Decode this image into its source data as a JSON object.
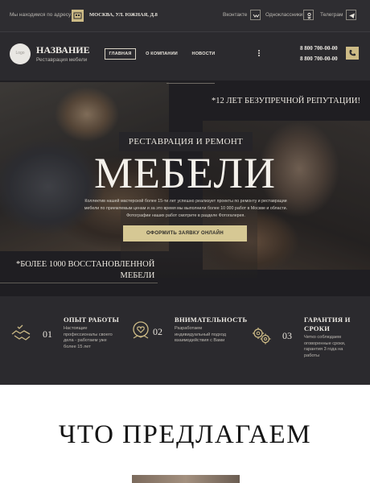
{
  "topbar": {
    "address_label": "Мы находимся по адресу:",
    "address": "МОСКВА, УЛ. ЮЖНАЯ, Д.8",
    "socials": [
      {
        "label": "Вконтакте",
        "icon": "vk-icon"
      },
      {
        "label": "Одноклассники",
        "icon": "odnoklassniki-icon"
      },
      {
        "label": "Телеграм",
        "icon": "telegram-icon"
      }
    ]
  },
  "header": {
    "logo_text": "Logo",
    "brand": "НАЗВАНИЕ",
    "brand_sub": "Реставрация мебели",
    "nav": [
      "ГЛАВНАЯ",
      "О КОМПАНИИ",
      "НОВОСТИ"
    ],
    "phones": [
      "8 800 700-00-00",
      "8 800 700-00-00"
    ]
  },
  "hero": {
    "tagline_top": "*12 ЛЕТ БЕЗУПРЕЧНОЙ РЕПУТАЦИИ!",
    "title_small": "РЕСТАВРАЦИЯ И РЕМОНТ",
    "title_big": "МЕБЕЛИ",
    "description": "Коллектив нашей мастерской более 15-ти лет успешно реализует проекты по ремонту и реставрации мебели по приемлемым ценам и за это время мы выполнили более 10 000 работ в Москве и области. Фотографии наших работ смотрите в разделе Фотогалерея.",
    "cta": "ОФОРМИТЬ ЗАЯВКУ ОНЛАЙН",
    "tagline_bottom_1": "*БОЛЕЕ 1000 ВОССТАНОВЛЕННОЙ",
    "tagline_bottom_2": "МЕБЕЛИ"
  },
  "features": [
    {
      "num": "01",
      "title": "ОПЫТ РАБОТЫ",
      "text_1": "Настоящие",
      "text_2": "профессионалы своего",
      "text_3": "дела - работаем уже",
      "text_4": "более 15 лет",
      "icon": "handshake-icon"
    },
    {
      "num": "02",
      "title": "ВНИМАТЕЛЬНОСТЬ",
      "text_1": "Разработаем",
      "text_2": "индивидуальный подход",
      "text_3": "взаимодействия с Вами",
      "text_4": "",
      "icon": "heart-hands-icon"
    },
    {
      "num": "03",
      "title_1": "ГАРАНТИЯ И",
      "title_2": "СРОКИ",
      "text_1": "Четко соблюдаем",
      "text_2": "оговоренные сроки,",
      "text_3": "гарантия 3 года на",
      "text_4": "работы",
      "icon": "gears-icon"
    }
  ],
  "offer": {
    "title": "ЧТО ПРЕДЛАГАЕМ"
  },
  "colors": {
    "accent": "#cdbb86",
    "dark": "#2b2a2e",
    "cta": "#d6c894"
  }
}
